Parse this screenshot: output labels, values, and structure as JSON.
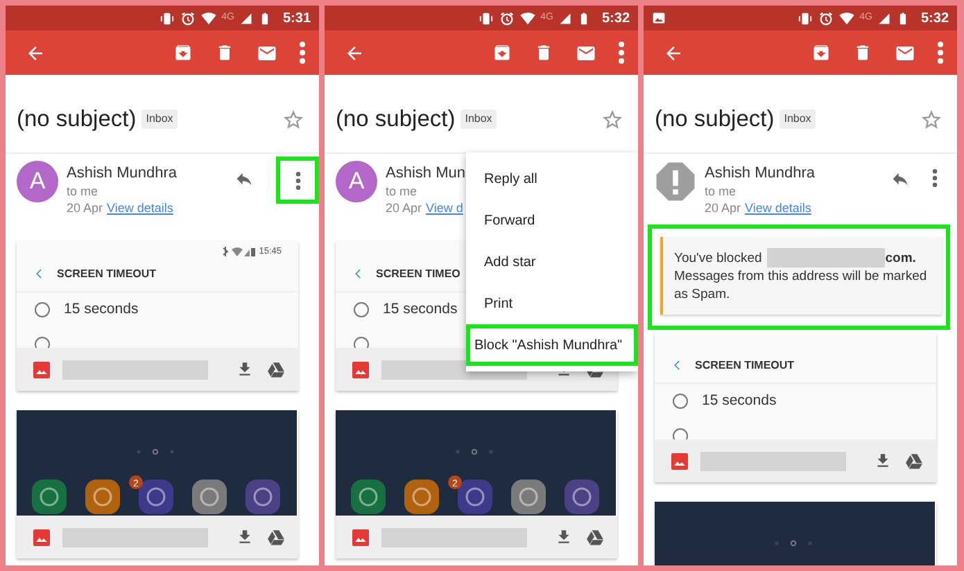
{
  "panels": [
    {
      "status_bar": {
        "notification_icon": false,
        "network": "4G",
        "time": "5:31"
      },
      "subject": "(no subject)",
      "label": "Inbox",
      "starred": false,
      "sender": {
        "avatar": {
          "kind": "letter",
          "initial": "A"
        },
        "name": "Ashish Mundhra",
        "recipient": "to me",
        "date": "20 Apr",
        "details_link": "View details",
        "actions_visible": true,
        "more_highlighted": true
      },
      "attachments": [
        {
          "kind": "screenshot",
          "status_time": "15:45",
          "title": "SCREEN TIMEOUT",
          "options": [
            {
              "label": "15 seconds",
              "selected": false
            },
            {
              "selected": false
            }
          ]
        },
        {
          "kind": "picture",
          "badge": "2",
          "cropped": false
        }
      ]
    },
    {
      "status_bar": {
        "notification_icon": false,
        "network": "4G",
        "time": "5:32"
      },
      "subject": "(no subject)",
      "label": "Inbox",
      "starred": false,
      "sender": {
        "avatar": {
          "kind": "letter",
          "initial": "A"
        },
        "name": "Ashish Mun",
        "recipient": "to me",
        "date": "20 Apr",
        "details_link": "View d"
      },
      "menu": [
        {
          "label": "Reply all",
          "highlighted": false
        },
        {
          "label": "Forward",
          "highlighted": false
        },
        {
          "label": "Add star",
          "highlighted": false
        },
        {
          "label": "Print",
          "highlighted": false
        },
        {
          "label": "Block \"Ashish Mundhra\"",
          "highlighted": true
        }
      ],
      "attachments": [
        {
          "kind": "screenshot",
          "title": "SCREEN TIMEO",
          "options": [
            {
              "label": "15 seconds",
              "selected": false
            },
            {
              "selected": false
            }
          ]
        },
        {
          "kind": "picture",
          "badge": "2",
          "cropped": false
        }
      ]
    },
    {
      "status_bar": {
        "notification_icon": true,
        "network": "4G",
        "time": "5:32"
      },
      "subject": "(no subject)",
      "label": "Inbox",
      "starred": false,
      "sender": {
        "avatar": {
          "kind": "warning"
        },
        "name": "Ashish Mundhra",
        "recipient": "to me",
        "date": "20 Apr",
        "details_link": "View details",
        "actions_visible": true,
        "more_highlighted": false
      },
      "notice": {
        "highlighted": true,
        "before": "You've blocked",
        "after": "com.",
        "message": "Messages from this address will be marked as Spam."
      },
      "attachments": [
        {
          "kind": "screenshot",
          "title": "SCREEN TIMEOUT",
          "options": [
            {
              "label": "15 seconds",
              "selected": false
            },
            {
              "selected": false
            }
          ]
        },
        {
          "kind": "picture",
          "cropped": true
        }
      ]
    }
  ]
}
